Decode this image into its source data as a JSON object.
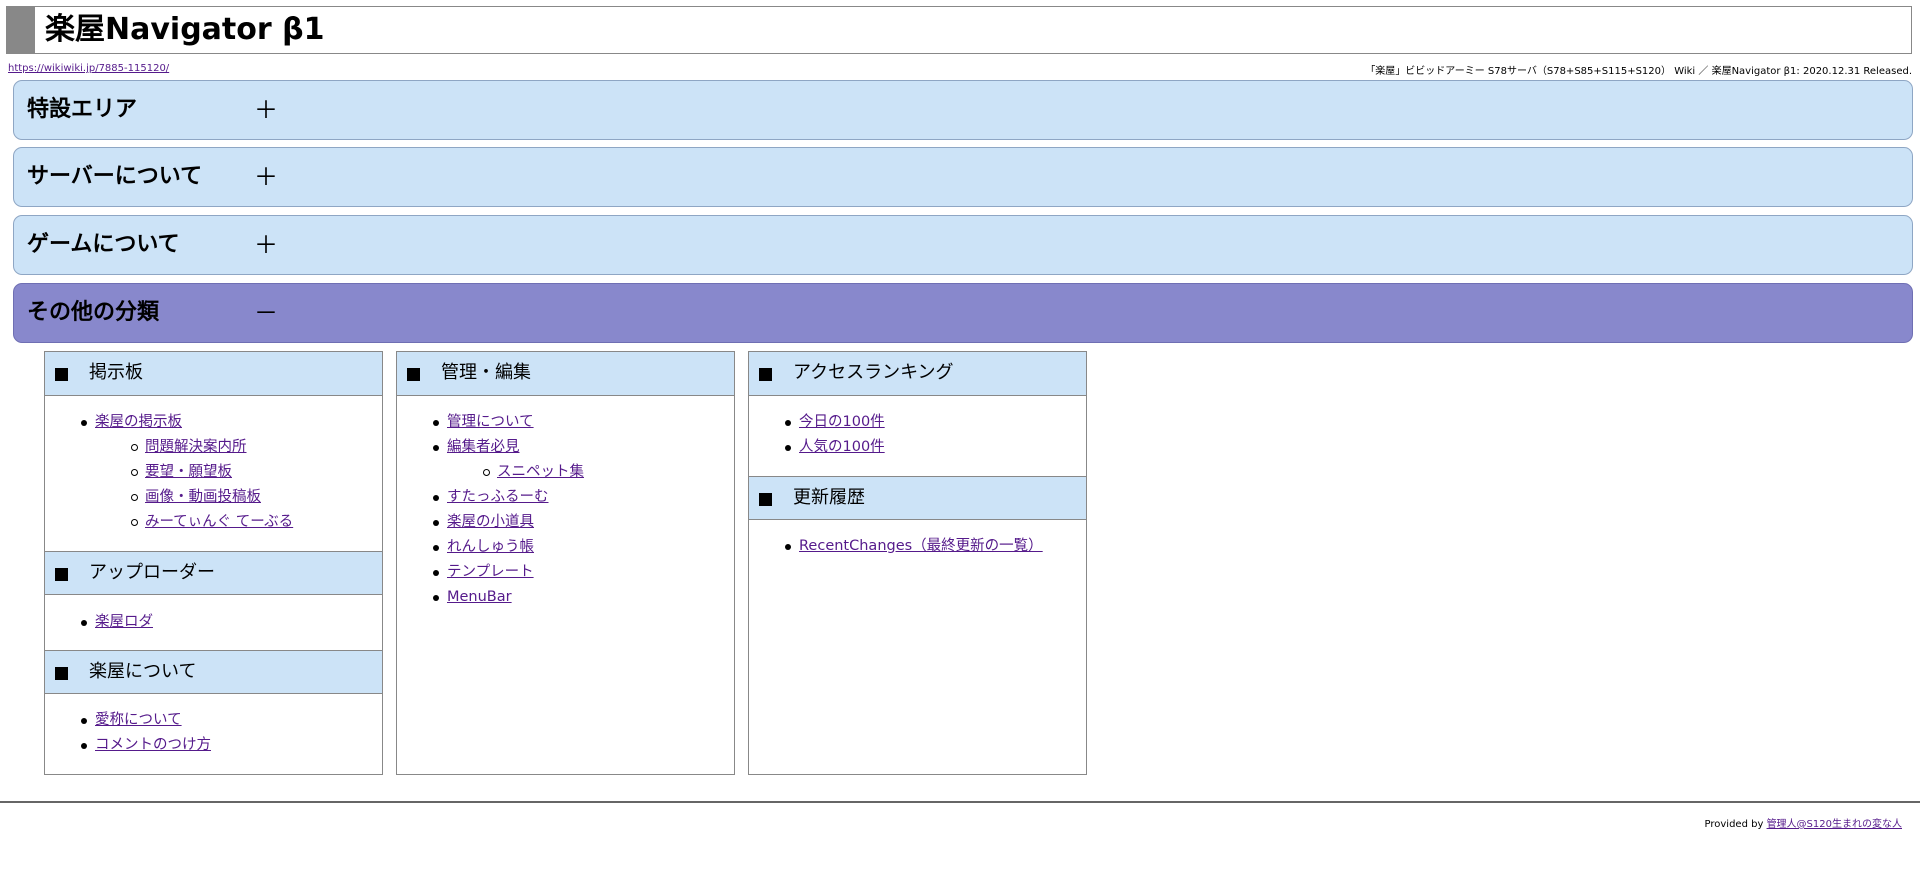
{
  "header": {
    "title": "楽屋Navigator β1",
    "url": "https://wikiwiki.jp/7885-115120/",
    "info": "「楽屋」ビビッドアーミー S78サーバ（S78+S85+S115+S120） Wiki ／ 楽屋Navigator β1: 2020.12.31 Released."
  },
  "accordion": [
    {
      "label": "特設エリア",
      "toggle": "＋"
    },
    {
      "label": "サーバーについて",
      "toggle": "＋"
    },
    {
      "label": "ゲームについて",
      "toggle": "＋"
    },
    {
      "label": "その他の分類",
      "toggle": "－"
    }
  ],
  "columns": [
    {
      "sections": [
        {
          "title": "掲示板",
          "items": [
            {
              "text": "楽屋の掲示板",
              "level": 1
            },
            {
              "text": "問題解決案内所",
              "level": 2
            },
            {
              "text": "要望・願望板",
              "level": 2
            },
            {
              "text": "画像・動画投稿板",
              "level": 2
            },
            {
              "text": "みーてぃんぐ てーぶる",
              "level": 2
            }
          ]
        },
        {
          "title": "アップローダー",
          "items": [
            {
              "text": "楽屋ロダ",
              "level": 1
            }
          ]
        },
        {
          "title": "楽屋について",
          "items": [
            {
              "text": "愛称について",
              "level": 1
            },
            {
              "text": "コメントのつけ方",
              "level": 1
            }
          ]
        }
      ]
    },
    {
      "sections": [
        {
          "title": "管理・編集",
          "items": [
            {
              "text": "管理について",
              "level": 1
            },
            {
              "text": "編集者必見",
              "level": 1
            },
            {
              "text": "スニペット集",
              "level": 2
            },
            {
              "text": "すたっふるーむ",
              "level": 1
            },
            {
              "text": "楽屋の小道具",
              "level": 1
            },
            {
              "text": "れんしゅう帳",
              "level": 1
            },
            {
              "text": "テンプレート",
              "level": 1
            },
            {
              "text": "MenuBar",
              "level": 1
            }
          ]
        }
      ]
    },
    {
      "sections": [
        {
          "title": "アクセスランキング",
          "items": [
            {
              "text": "今日の100件",
              "level": 1
            },
            {
              "text": "人気の100件",
              "level": 1
            }
          ]
        },
        {
          "title": "更新履歴",
          "items": [
            {
              "text": "RecentChanges（最終更新の一覧）",
              "level": 1
            }
          ]
        }
      ]
    }
  ],
  "footer": {
    "prefix": "Provided by",
    "link": "管理人@S120生まれの変な人"
  },
  "colors": {
    "accordion_closed": "#cce3f7",
    "accordion_open": "#8888cc",
    "section_header": "#cce3f7",
    "link": "#551a8b"
  }
}
